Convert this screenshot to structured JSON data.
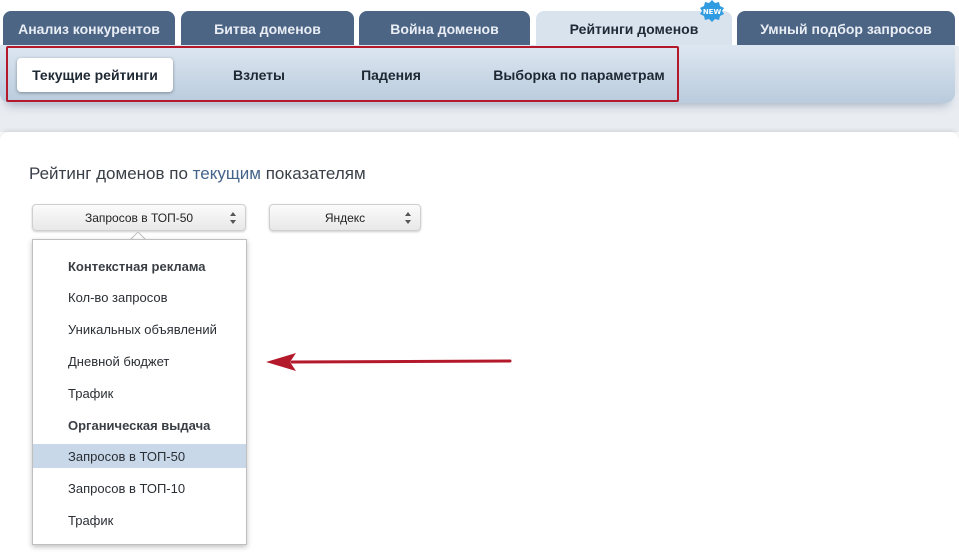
{
  "tabs": [
    {
      "label": "Анализ конкурентов"
    },
    {
      "label": "Битва доменов"
    },
    {
      "label": "Война доменов"
    },
    {
      "label": "Рейтинги доменов"
    },
    {
      "label": "Умный подбор запросов"
    }
  ],
  "new_badge": "NEW",
  "subtabs": [
    {
      "label": "Текущие рейтинги"
    },
    {
      "label": "Взлеты"
    },
    {
      "label": "Падения"
    },
    {
      "label": "Выборка по параметрам"
    }
  ],
  "page_title": {
    "part1": "Рейтинг доменов по ",
    "highlight": "текущим",
    "part2": " показателям"
  },
  "metric_select": {
    "value": "Запросов в ТОП-50"
  },
  "engine_select": {
    "value": "Яндекс"
  },
  "dropdown": {
    "items": [
      {
        "label": "Контекстная реклама",
        "type": "group"
      },
      {
        "label": "Кол-во запросов",
        "type": "option"
      },
      {
        "label": "Уникальных объявлений",
        "type": "option"
      },
      {
        "label": "Дневной бюджет",
        "type": "option"
      },
      {
        "label": "Трафик",
        "type": "option"
      },
      {
        "label": "Органическая выдача",
        "type": "group"
      },
      {
        "label": "Запросов в ТОП-50",
        "type": "option",
        "selected": true
      },
      {
        "label": "Запросов в ТОП-10",
        "type": "option"
      },
      {
        "label": "Трафик",
        "type": "option"
      }
    ]
  },
  "colors": {
    "tab_bg": "#4d6585",
    "tab_active_bg": "#d9e3ee",
    "highlight_border": "#b3192b",
    "selected_row": "#c9d8e9",
    "arrow": "#b3192b",
    "badge": "#2f9be0"
  }
}
